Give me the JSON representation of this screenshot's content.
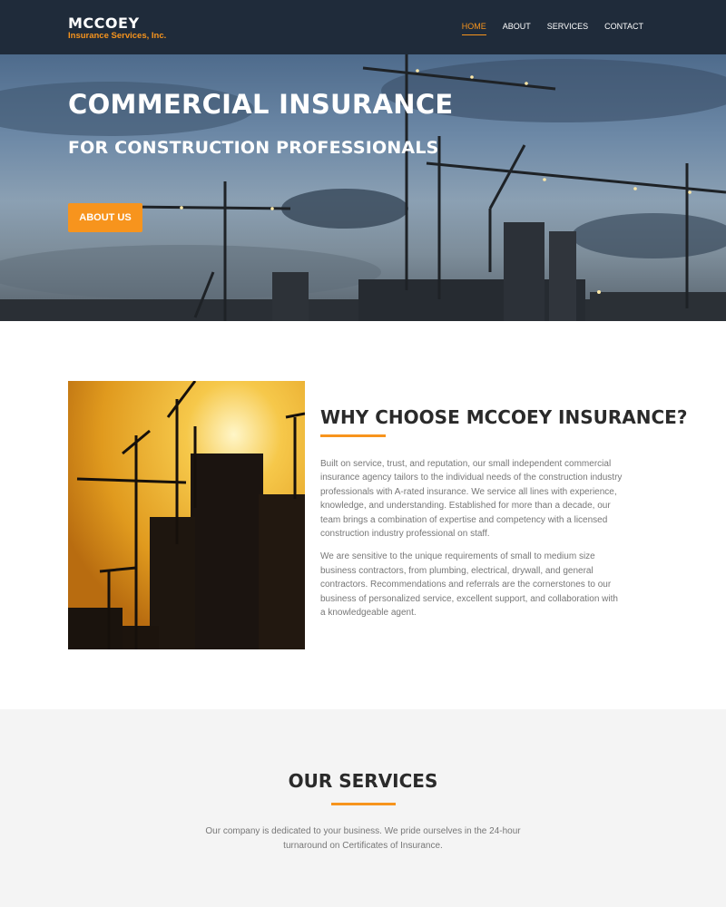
{
  "header": {
    "logo_main": "MCCOEY",
    "logo_sub": "Insurance Services, Inc.",
    "nav": [
      "HOME",
      "ABOUT",
      "SERVICES",
      "CONTACT"
    ],
    "active_nav": "HOME"
  },
  "hero": {
    "title": "COMMERCIAL INSURANCE",
    "subtitle": "FOR CONSTRUCTION PROFESSIONALS",
    "button_label": "ABOUT US"
  },
  "why": {
    "title": "WHY CHOOSE MCCOEY INSURANCE?",
    "paragraphs": [
      "Built on service, trust, and reputation, our small independent commercial insurance agency tailors to the individual needs of the construction industry professionals with A-rated insurance. We service all lines with experience, knowledge, and understanding. Established for more than a decade, our team brings a combination of expertise and competency with a licensed construction industry professional on staff.",
      "We are sensitive to the unique requirements of small to medium size business contractors, from plumbing, electrical, drywall, and general contractors. Recommendations and referrals are the cornerstones to our business of personalized service, excellent support, and collaboration with a knowledgeable agent."
    ]
  },
  "services": {
    "title": "OUR SERVICES",
    "body": "Our company is dedicated to your business. We pride ourselves in the 24-hour turnaround on Certificates of Insurance."
  },
  "colors": {
    "accent": "#f7941d",
    "header_bg": "#1f2b3a",
    "services_bg": "#f4f4f4"
  }
}
